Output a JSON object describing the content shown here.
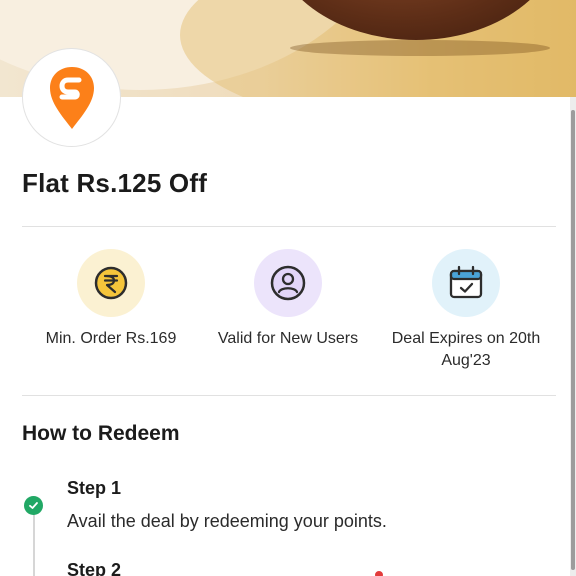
{
  "offer": {
    "title": "Flat Rs.125 Off"
  },
  "brand": {
    "logo_icon": "swiggy-logo-icon",
    "color": "#fc8019"
  },
  "features": [
    {
      "icon": "rupee-coin-icon",
      "label": "Min. Order Rs.169"
    },
    {
      "icon": "user-profile-icon",
      "label": "Valid for New Users"
    },
    {
      "icon": "calendar-check-icon",
      "label": "Deal Expires on 20th Aug'23"
    }
  ],
  "redeem": {
    "title": "How to Redeem",
    "steps": [
      {
        "title": "Step 1",
        "description": "Avail the deal by redeeming your points.",
        "status_icon": "check-icon",
        "status_color": "#21a865"
      },
      {
        "title": "Step 2"
      }
    ]
  }
}
